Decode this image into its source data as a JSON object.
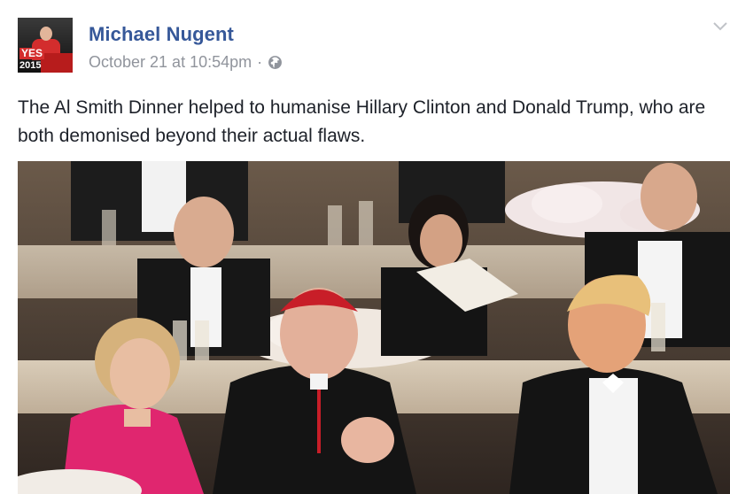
{
  "post": {
    "author": "Michael Nugent",
    "avatar_badge": {
      "top": "YES",
      "bottom": "2015"
    },
    "timestamp": "October 21 at 10:54pm",
    "separator": "·",
    "audience_icon": "globe-icon",
    "menu_icon": "chevron-down-icon",
    "text": "The Al Smith Dinner helped to humanise Hillary Clinton and Donald Trump, who are both demonised beyond their actual flaws."
  },
  "colors": {
    "author_link": "#365899",
    "meta_gray": "#90949c",
    "body_text": "#1d2129"
  }
}
